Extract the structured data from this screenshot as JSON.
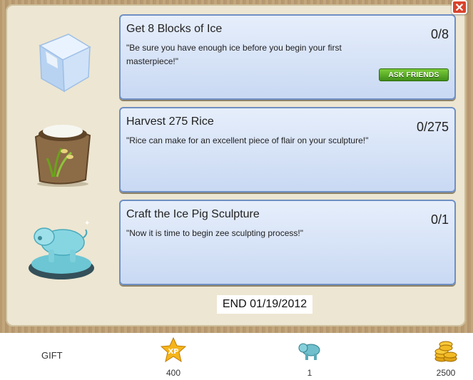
{
  "dialog": {
    "close_label": "✕"
  },
  "tasks": [
    {
      "title": "Get 8 Blocks of Ice",
      "description": "\"Be sure you have enough ice before you begin your first masterpiece!\"",
      "progress": "0/8",
      "ask_label": "ASK FRIENDS",
      "icon": "ice-block-icon"
    },
    {
      "title": "Harvest 275 Rice",
      "description": "\"Rice can make for an excellent piece of flair on your sculpture!\"",
      "progress": "0/275",
      "icon": "rice-sack-icon"
    },
    {
      "title": "Craft the Ice Pig Sculpture",
      "description": "\"Now it is time to begin zee sculpting process!\"",
      "progress": "0/1",
      "icon": "ice-pig-sculpture-icon"
    }
  ],
  "end_date": "END 01/19/2012",
  "rewards": {
    "gift_label": "GIFT",
    "items": [
      {
        "icon": "xp-star-icon",
        "value": "400"
      },
      {
        "icon": "ice-pig-icon",
        "value": "1"
      },
      {
        "icon": "gold-coins-icon",
        "value": "2500"
      }
    ]
  },
  "colors": {
    "ask_button": "#4fa020",
    "task_border": "#6f8fc3",
    "close_button": "#d9432c"
  }
}
